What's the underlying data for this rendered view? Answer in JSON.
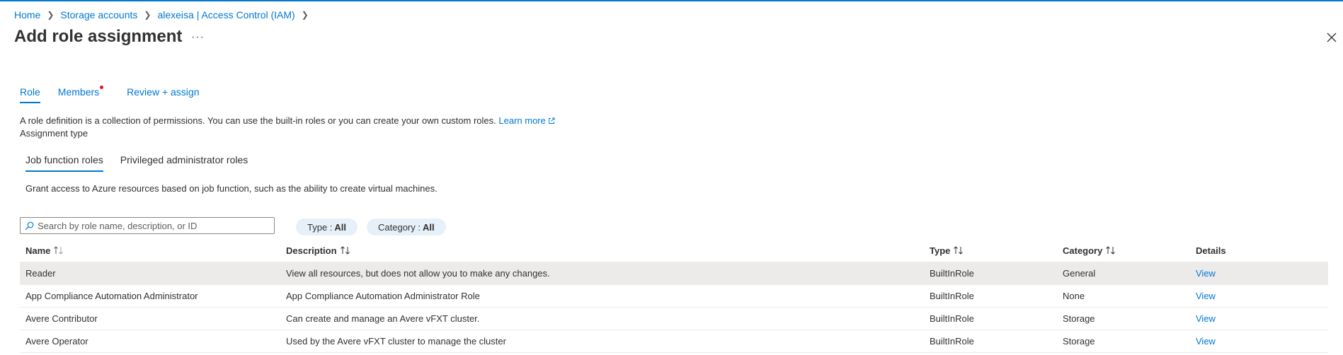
{
  "breadcrumb": {
    "home": "Home",
    "storage_accounts": "Storage accounts",
    "resource": "alexeisa | Access Control (IAM)"
  },
  "page": {
    "title": "Add role assignment",
    "more_label": "···"
  },
  "tabs": [
    {
      "label": "Role",
      "active": true
    },
    {
      "label": "Members",
      "has_indicator": true
    },
    {
      "label": "Review + assign"
    }
  ],
  "intro": {
    "text": "A role definition is a collection of permissions. You can use the built-in roles or you can create your own custom roles.",
    "learn_more": "Learn more",
    "assignment_type": "Assignment type"
  },
  "subtabs": [
    {
      "label": "Job function roles",
      "active": true
    },
    {
      "label": "Privileged administrator roles"
    }
  ],
  "grant_text": "Grant access to Azure resources based on job function, such as the ability to create virtual machines.",
  "search": {
    "placeholder": "Search by role name, description, or ID",
    "value": ""
  },
  "filters": {
    "type_label": "Type :",
    "type_value": "All",
    "category_label": "Category :",
    "category_value": "All"
  },
  "table": {
    "columns": {
      "name": "Name",
      "description": "Description",
      "type": "Type",
      "category": "Category",
      "details": "Details"
    },
    "rows": [
      {
        "name": "Reader",
        "description": "View all resources, but does not allow you to make any changes.",
        "type": "BuiltInRole",
        "category": "General",
        "details": "View",
        "selected": true
      },
      {
        "name": "App Compliance Automation Administrator",
        "description": "App Compliance Automation Administrator Role",
        "type": "BuiltInRole",
        "category": "None",
        "details": "View"
      },
      {
        "name": "Avere Contributor",
        "description": "Can create and manage an Avere vFXT cluster.",
        "type": "BuiltInRole",
        "category": "Storage",
        "details": "View"
      },
      {
        "name": "Avere Operator",
        "description": "Used by the Avere vFXT cluster to manage the cluster",
        "type": "BuiltInRole",
        "category": "Storage",
        "details": "View"
      }
    ]
  },
  "colors": {
    "accent": "#0078d4",
    "indicator": "#e81123",
    "selected_row": "#edebe9",
    "pill_bg": "#e6f0f8"
  },
  "icons": {
    "close": "close-icon",
    "search": "search-icon",
    "external": "external-link-icon",
    "sort": "sort-icon",
    "chevron": "chevron-right-icon"
  }
}
